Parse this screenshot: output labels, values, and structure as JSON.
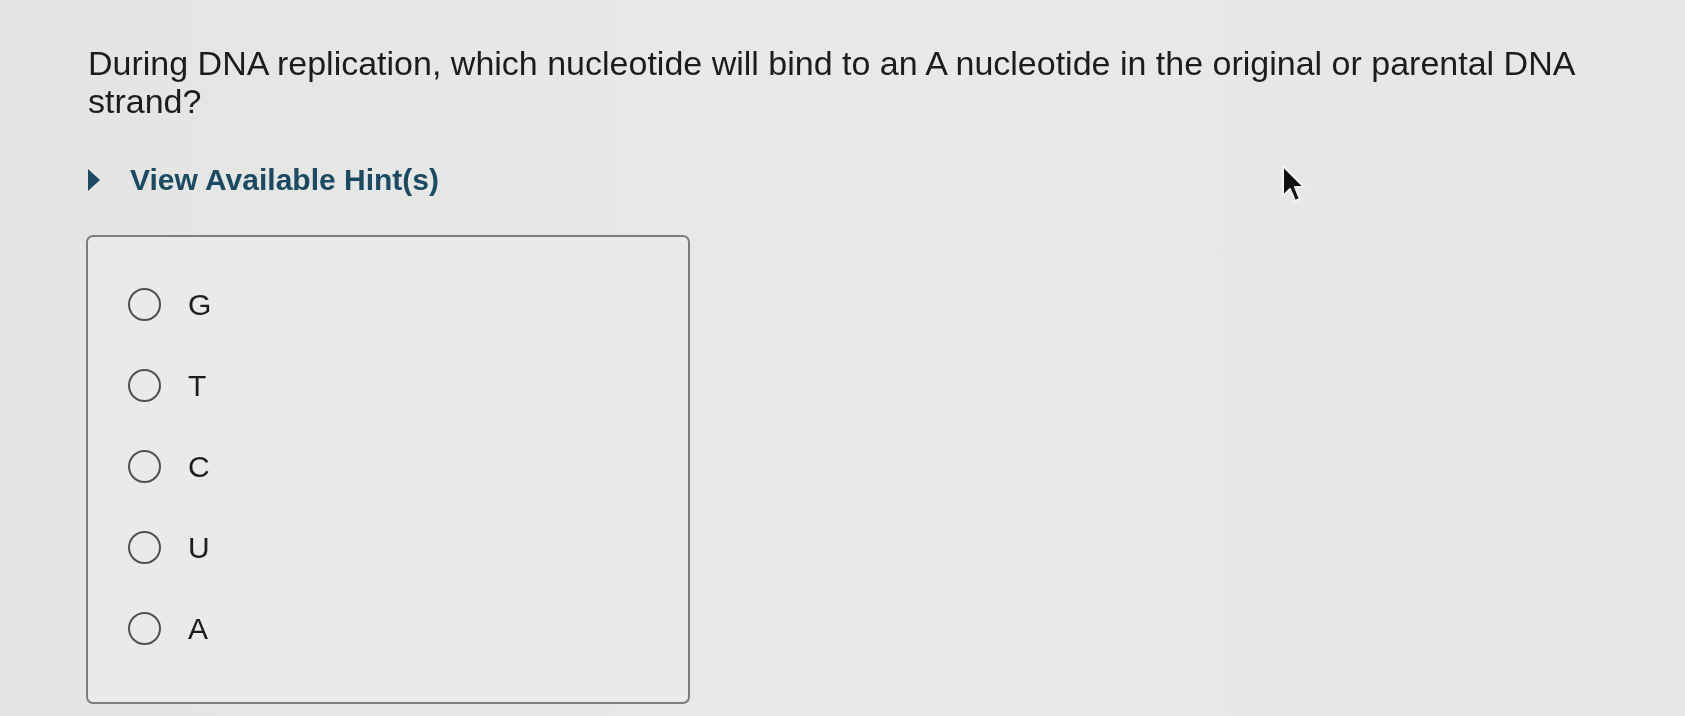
{
  "question": {
    "text": "During DNA replication, which nucleotide will bind to an A nucleotide in the original or parental DNA strand?"
  },
  "hint_toggle": {
    "label": "View Available Hint(s)",
    "expanded": false
  },
  "choices": [
    {
      "label": "G",
      "selected": false
    },
    {
      "label": "T",
      "selected": false
    },
    {
      "label": "C",
      "selected": false
    },
    {
      "label": "U",
      "selected": false
    },
    {
      "label": "A",
      "selected": false
    }
  ]
}
